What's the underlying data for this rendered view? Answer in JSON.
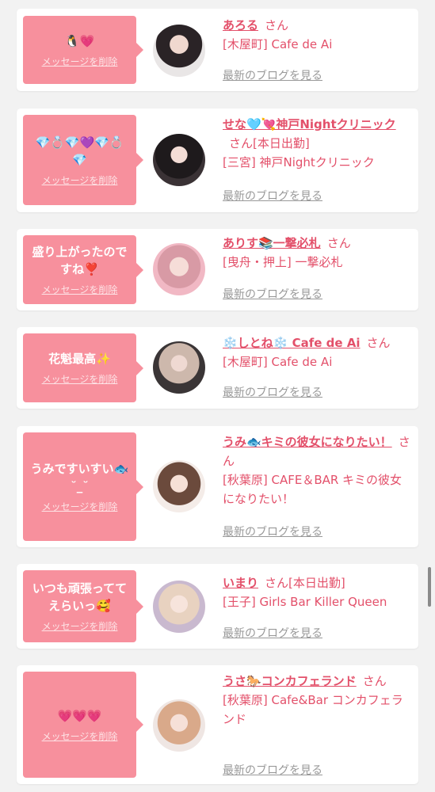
{
  "delete_label": "メッセージを削除",
  "blog_label": "最新のブログを見る",
  "san_label": "さん",
  "colors": {
    "accent": "#e3506a",
    "bubble": "#f7909d",
    "muted": "#999999"
  },
  "items": [
    {
      "message": "🐧💗",
      "name": "あろる",
      "extra": "",
      "shop": "[木屋町] Cafe de Ai"
    },
    {
      "message": "💎💍💎💜💎💍💎",
      "name": "せな🩵💘神戸Nightクリニック",
      "extra": "[本日出勤]",
      "shop": "[三宮] 神戸Nightクリニック"
    },
    {
      "message": "盛り上がったのですね❣️",
      "name": "ありす📚一撃必札",
      "extra": "",
      "shop": "[曳舟・押上] 一撃必札"
    },
    {
      "message": "花魁最高✨",
      "name": "❄️しとね❄️ Cafe de Ai",
      "extra": "",
      "shop": "[木屋町] Cafe de Ai"
    },
    {
      "message": "うみですいすい🐟 ˘_˘",
      "name": "うみ🐟キミの彼女になりたい！",
      "extra": "",
      "shop": "[秋葉原] CAFE＆BAR キミの彼女になりたい！"
    },
    {
      "message": "いつも頑張っててえらいっ🥰",
      "name": "いまり",
      "extra": "[本日出勤]",
      "shop": "[王子] Girls Bar Killer Queen"
    },
    {
      "message": "💗💗💗",
      "name": "うさ🐎コンカフェランド",
      "extra": "",
      "shop": "[秋葉原] Cafe&Bar コンカフェランド"
    }
  ]
}
